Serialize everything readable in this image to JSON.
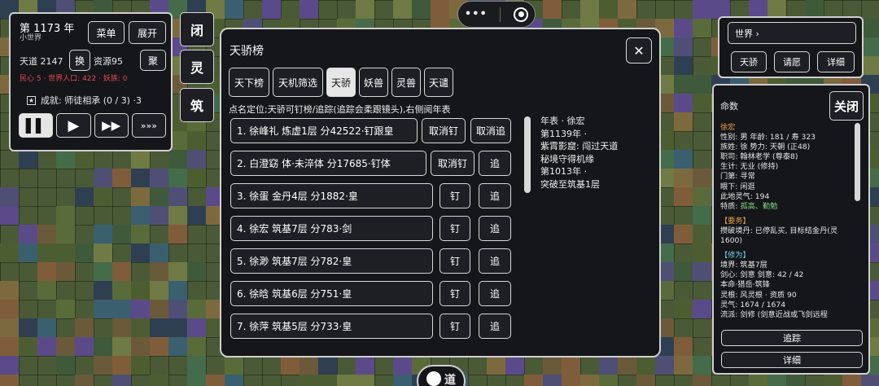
{
  "status_panel": {
    "year_text": "第 1173 年",
    "world_text": "小世界",
    "menu_label": "菜单",
    "expand_label": "展开",
    "tiandao_text": "天道 2147",
    "swap_label": "换",
    "resources_text": "资源95",
    "gather_label": "聚",
    "stats_text": "民心 5 · 世界人口: 422 · 妖族: 0",
    "achievement_text": "成就: 师徒相承 (0 / 3) ·3"
  },
  "side_buttons": [
    "闭",
    "灵",
    "筑"
  ],
  "top_pill": {
    "dots": "•••"
  },
  "modal": {
    "title": "天骄榜",
    "close_label": "✕",
    "tabs": [
      "天下榜",
      "天机筛选",
      "天骄",
      "妖兽",
      "灵兽",
      "天谴"
    ],
    "selected_tab": 2,
    "hint": "点名定位;天骄可钉榜/追踪(追踪会柔跟镜头),右侧阅年表",
    "entries": [
      {
        "text": "1. 徐峰礼  炼虚1层  分42522·钉跟皇",
        "pin": "取消钉",
        "track": "取消追"
      },
      {
        "text": "2. 白澄窈  体·未淬体  分17685·钉体",
        "pin": "取消钉",
        "track": "追"
      },
      {
        "text": "3. 徐蛋  金丹4层  分1882·皇",
        "pin": "钉",
        "track": "追"
      },
      {
        "text": "4. 徐宏  筑基7层  分783·剑",
        "pin": "钉",
        "track": "追"
      },
      {
        "text": "5. 徐渺  筑基7层  分782·皇",
        "pin": "钉",
        "track": "追"
      },
      {
        "text": "6. 徐晗  筑基6层  分751·皇",
        "pin": "钉",
        "track": "追"
      },
      {
        "text": "7. 徐萍  筑基5层  分733·皇",
        "pin": "钉",
        "track": "追"
      }
    ],
    "chronicle": [
      "年表 · 徐宏",
      "第1139年 ·",
      "紫霄影窟: 闯过天道",
      "秘境守得机缘",
      "第1013年 ·",
      "突破至筑基1层"
    ]
  },
  "right_top": {
    "world_label": "世界 ›",
    "buttons": [
      "天骄",
      "请愿",
      "详细"
    ]
  },
  "fate_panel": {
    "title": "命数",
    "close_label": "关闭",
    "name": "徐宏",
    "lines": [
      "性别: 男   年龄: 181 / 寿 323",
      "族姓: 徐   势力: 天朝 (正48)",
      "职司: 翰林老学 (尊泰8)",
      "生计: 无业 (修持)",
      "门第: 寻常",
      "眼下: 闲逛",
      "此地灵气: 194"
    ],
    "traits_label": "特质: ",
    "traits_value": "孤高、勤勉",
    "duty_header": "【要务】",
    "duty_text": "攒破境丹: 已停乱买, 目标结金丹(灵1600)",
    "cultivation_header": "【修为】",
    "cultivation_lines": [
      "境界: 筑基7层",
      "剑心: 剑意   剑意: 42 / 42",
      "本命·猎岳·筑锋",
      "灵根: 风灵根 · 资质 90",
      "灵气: 1674 / 1674",
      "流派: 剑修 (剑意近战或飞剑远程"
    ],
    "track_label": "追踪",
    "detail_label": "详细"
  },
  "bottom_button": {
    "label": "道"
  },
  "colors": {
    "panel_bg": "#15161a",
    "border": "#cfcfcf",
    "red_stat": "#e24b4b",
    "green_trait": "#7fd37f",
    "duty_orange": "#e8a24a",
    "cultivation_cyan": "#6fd0e6"
  }
}
